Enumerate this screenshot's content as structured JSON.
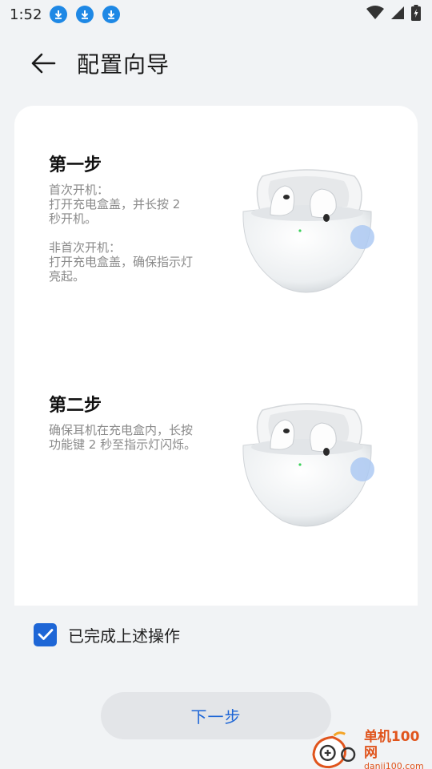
{
  "status_bar": {
    "time": "1:52",
    "notification_icons": [
      "download-icon",
      "download-icon",
      "download-icon"
    ],
    "right_icons": [
      "wifi-icon",
      "signal-icon",
      "battery-charging-icon"
    ]
  },
  "header": {
    "title": "配置向导",
    "back_icon": "arrow-left-icon"
  },
  "steps": [
    {
      "title": "第一步",
      "lines": [
        "首次开机：",
        "打开充电盒盖，并长按 2",
        "秒开机。"
      ],
      "lines2": [
        "非首次开机：",
        "打开充电盒盖，确保指示灯",
        "亮起。"
      ],
      "image": "earbuds-case-image"
    },
    {
      "title": "第二步",
      "lines": [
        "确保耳机在充电盒内，长按",
        "功能键 2 秒至指示灯闪烁。"
      ],
      "image": "earbuds-case-image"
    }
  ],
  "confirm": {
    "checked": true,
    "label": "已完成上述操作"
  },
  "next_button": {
    "label": "下一步"
  },
  "watermark": {
    "title": "单机100网",
    "url": "danji100.com"
  },
  "colors": {
    "accent": "#1e66d6",
    "background": "#f1f3f5",
    "card": "#ffffff",
    "secondary_text": "#8a8a8a",
    "watermark": "#e0541c"
  }
}
